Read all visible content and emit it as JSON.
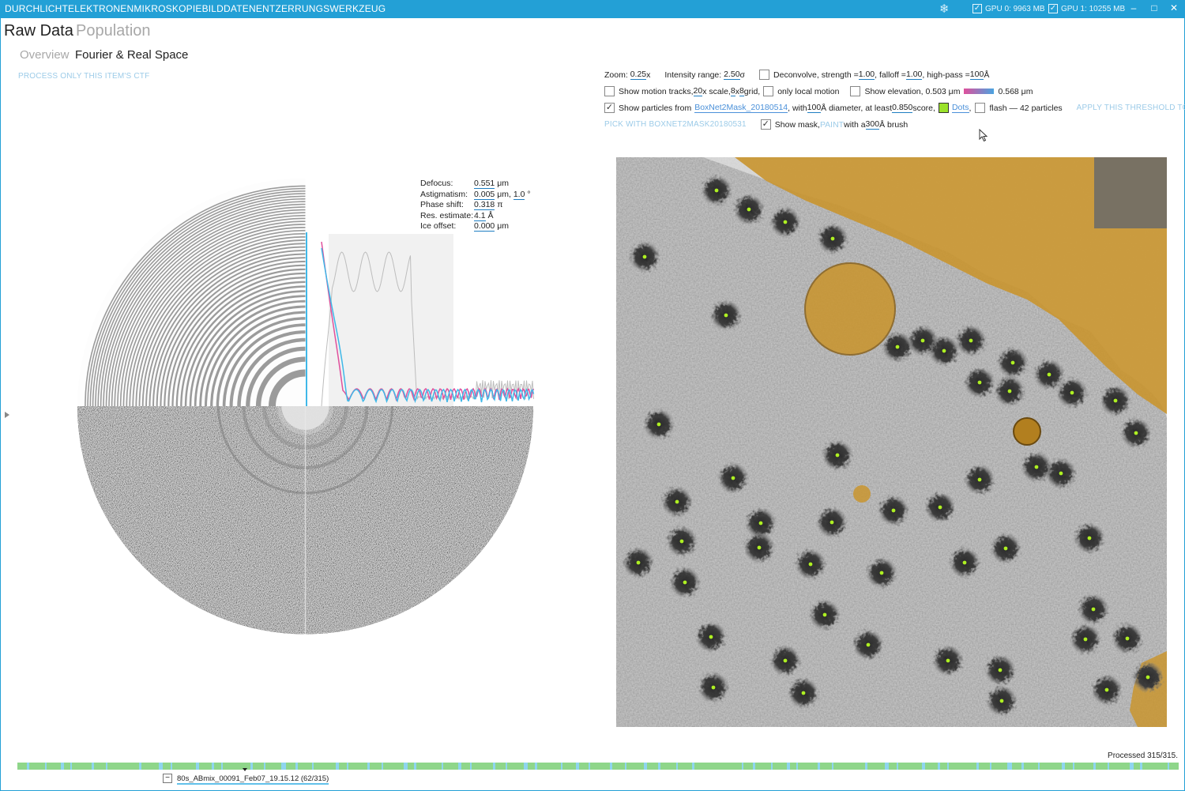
{
  "window": {
    "title": "DURCHLICHTELEKTRONENMIKROSKOPIEBILDDATENENTZERRUNGSWERKZEUG",
    "gpu0": "GPU 0: 9963 MB",
    "gpu1": "GPU 1: 10255 MB",
    "minimize": "–",
    "maximize": "□",
    "close": "✕"
  },
  "tabs": {
    "raw_data": "Raw Data",
    "population": "Population"
  },
  "subtabs": {
    "overview": "Overview",
    "fourier_real": "Fourier & Real Space"
  },
  "process_ctf_link": "PROCESS ONLY THIS ITEM'S CTF",
  "options": {
    "zoom_label": "Zoom:",
    "zoom_value": "0.25",
    "zoom_unit": " x",
    "intensity_label": "Intensity range:",
    "intensity_value": "2.50",
    "intensity_unit": " σ",
    "deconvolve_label": "Deconvolve, strength = ",
    "deconvolve_strength": "1.00",
    "falloff_label": ", falloff = ",
    "falloff_value": "1.00",
    "highpass_label": ", high-pass = ",
    "highpass_value": "100",
    "highpass_unit": " Å",
    "motion_label": "Show motion tracks, ",
    "motion_scale": "20",
    "motion_scale_unit": " x scale, ",
    "grid_x": "8",
    "grid_x_sep": " x ",
    "grid_y": "8",
    "grid_unit": " grid,",
    "local_motion_label": "only local motion",
    "elevation_label": "Show elevation, 0.503 μm",
    "elevation_max": "0.568 μm",
    "particles_label": "Show particles from ",
    "particles_source": "BoxNet2Mask_20180514",
    "particles_with": ", with ",
    "particles_diameter": "100",
    "particles_diameter_unit": " Å diameter, at least ",
    "particles_score": "0.850",
    "particles_score_unit": " score,",
    "dots_label": "Dots",
    "dots_sep": ",",
    "flash_label": "flash — 42 particles",
    "apply_threshold_link": "APPLY THIS THRESHOLD TO ALL MIC",
    "pick_link": "PICK WITH BOXNET2MASK20180531",
    "mask_label": "Show mask, ",
    "paint_link": "PAINT",
    "brush_pre": " with a ",
    "brush_size": "300",
    "brush_unit": " Å brush"
  },
  "ctf": {
    "defocus_label": "Defocus:",
    "defocus_value": "0.551",
    "defocus_unit": " μm",
    "astig_label": "Astigmatism:",
    "astig_value": "0.005",
    "astig_unit": " μm, ",
    "astig_angle": "1.0",
    "astig_angle_unit": " °",
    "phase_label": "Phase shift:",
    "phase_value": "0.318",
    "phase_unit": " π",
    "res_label": "Res. estimate:",
    "res_value": "4.1",
    "res_unit": " Å",
    "ice_label": "Ice offset:",
    "ice_value": "0.000",
    "ice_unit": " μm"
  },
  "status": {
    "processed": "Processed 315/315."
  },
  "current_item": {
    "toggle": "−",
    "name": "80s_ABmix_00091_Feb07_19.15.12 (62/315)"
  },
  "colors": {
    "accent": "#23a0d6",
    "timeline_done": "#8fd68a",
    "timeline_filtered": "#8fd5ef",
    "fit_magenta": "#e0509c",
    "fit_cyan": "#3fb8e8",
    "mask_gold": "#c9952f",
    "particle_dot": "#aef022"
  },
  "icons": [
    "snowflake-icon",
    "checkbox-icon",
    "minimize-icon",
    "maximize-icon",
    "close-icon",
    "expand-arrow-icon",
    "mouse-cursor-icon"
  ]
}
